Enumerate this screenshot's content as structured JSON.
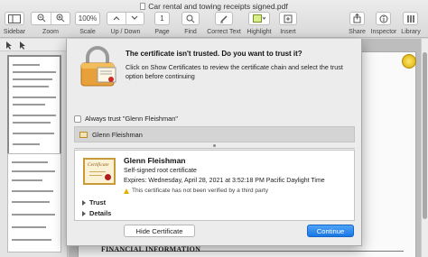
{
  "window": {
    "title": "Car rental and towing receipts signed.pdf"
  },
  "toolbar": {
    "sidebar_label": "Sidebar",
    "zoom_label": "Zoom",
    "scale_value": "100%",
    "scale_label": "Scale",
    "updown_label": "Up / Down",
    "page_value": "1",
    "page_label": "Page",
    "find_label": "Find",
    "correct_text_label": "Correct Text",
    "highlight_label": "Highlight",
    "insert_label": "Insert",
    "share_label": "Share",
    "inspector_label": "Inspector",
    "library_label": "Library"
  },
  "document": {
    "visible_heading": "FINANCIAL INFORMATION"
  },
  "dialog": {
    "title": "The certificate isn't trusted. Do you want to trust it?",
    "message": "Click on Show Certificates to review the certificate chain and select the trust option before continuing",
    "always_trust_label": "Always trust \"Glenn Fleishman\"",
    "always_trust_checked": false,
    "chain_items": [
      "Glenn Fleishman"
    ],
    "certificate": {
      "name": "Glenn Fleishman",
      "type": "Self-signed root certificate",
      "expires": "Expires: Wednesday, April 28, 2021 at 3:52:18 PM Pacific Daylight Time",
      "warning": "This certificate has not been verified by a third party",
      "image_text": "Certificate"
    },
    "sections": [
      "Trust",
      "Details"
    ],
    "hide_button": "Hide Certificate",
    "continue_button": "Continue"
  },
  "colors": {
    "accent": "#1a76e3",
    "warning": "#e2b100"
  },
  "icons": [
    "lock-certificate-icon",
    "sidebar-icon",
    "zoom-out-icon",
    "zoom-in-icon",
    "search-icon",
    "pen-icon",
    "highlighter-icon",
    "insert-icon",
    "share-icon",
    "inspector-icon",
    "library-icon",
    "certificate-icon",
    "warning-icon"
  ]
}
